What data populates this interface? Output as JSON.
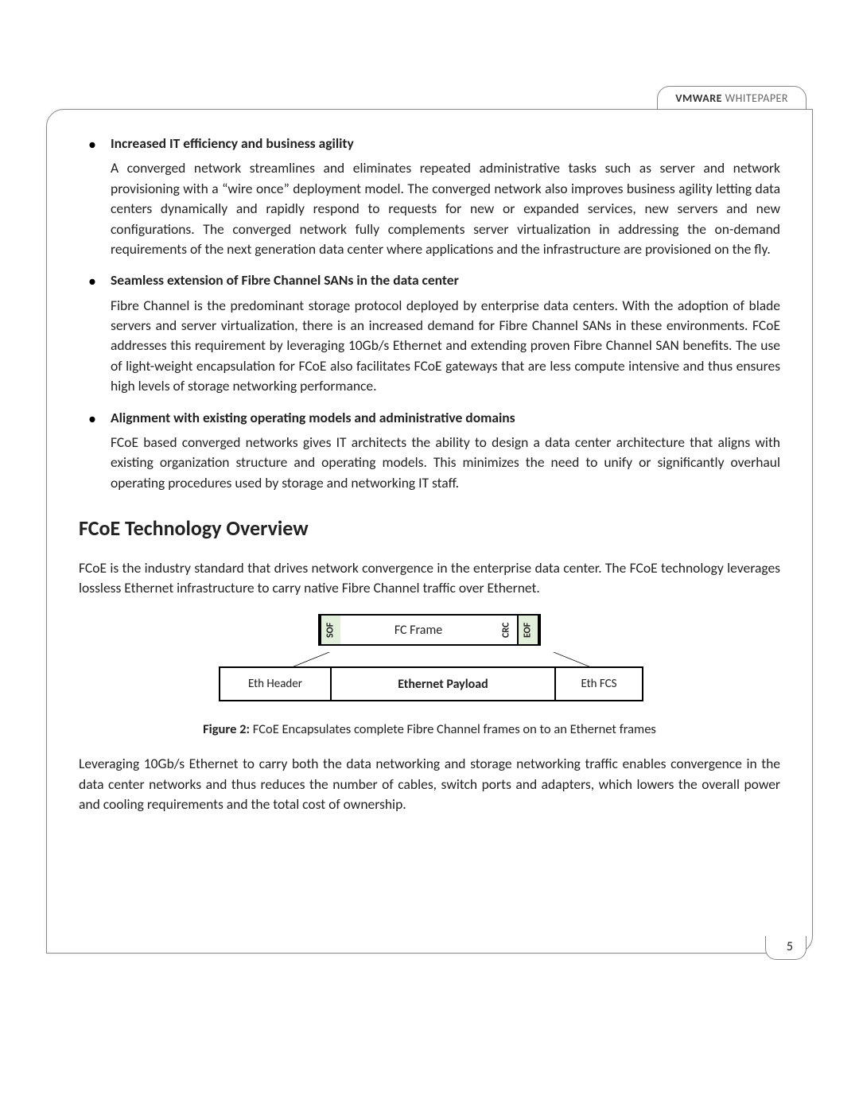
{
  "header": {
    "brand": "VMWARE",
    "label": "WHITEPAPER"
  },
  "bullets": [
    {
      "head": "Increased IT efficiency and business agility",
      "body": "A converged network streamlines and eliminates repeated administrative tasks such as server and network provisioning with a “wire once” deployment model. The converged network also improves business agility letting data centers dynamically and rapidly respond to requests for new or expanded services, new servers and new configurations. The converged network fully complements server virtualization in addressing the on-demand requirements of the next generation data center where applications and the infrastructure are provisioned on the fly."
    },
    {
      "head": "Seamless extension of Fibre Channel SANs in the data center",
      "body": "Fibre Channel is the predominant storage protocol deployed by enterprise data centers. With the adoption of blade servers and server virtualization, there is an increased demand for Fibre Channel SANs in these environments. FCoE addresses this requirement by leveraging 10Gb/s Ethernet and extending proven Fibre Channel SAN benefits. The use of light-weight encapsulation for FCoE also facilitates FCoE gateways that are less compute intensive and thus ensures high levels of storage networking performance."
    },
    {
      "head": "Alignment with existing operating models and administrative domains",
      "body": "FCoE based converged networks gives IT architects the ability to design a data center architecture that aligns with existing organization structure and operating models. This minimizes the need to unify or significantly overhaul operating procedures used by storage and networking IT staff."
    }
  ],
  "section_title": "FCoE Technology Overview",
  "intro_para": "FCoE is the industry standard that drives network convergence in the enterprise data center. The FCoE technology leverages lossless Ethernet infrastructure to carry native Fibre Channel traffic over Ethernet.",
  "figure": {
    "sof": "SOF",
    "fc_frame": "FC Frame",
    "crc": "CRC",
    "eof": "EOF",
    "eth_header": "Eth Header",
    "eth_payload": "Ethernet Payload",
    "eth_fcs": "Eth FCS",
    "caption_num": "Figure 2:",
    "caption_text": " FCoE Encapsulates complete Fibre Channel frames on to an Ethernet frames"
  },
  "closing_para": "Leveraging 10Gb/s Ethernet to carry both the data networking and storage networking traffic enables convergence in the data center networks and thus reduces the number of cables, switch ports and adapters, which lowers the overall power and cooling requirements and the total cost of ownership.",
  "page_number": "5"
}
